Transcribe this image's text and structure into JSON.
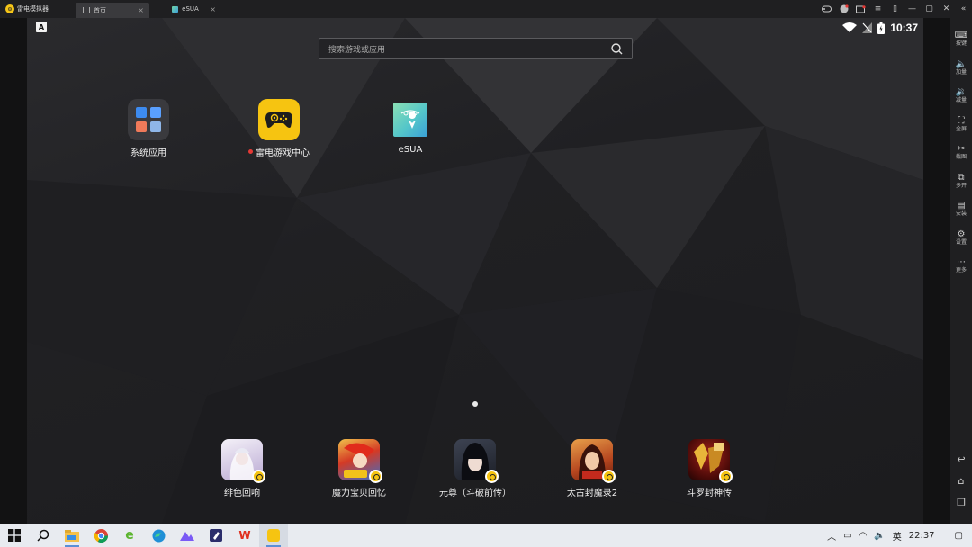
{
  "window": {
    "app_title": "雷电模拟器",
    "tabs": [
      {
        "label": "首页",
        "active": true
      },
      {
        "label": "eSUA",
        "active": false
      }
    ]
  },
  "android": {
    "badge": "A",
    "clock": "10:37",
    "search_placeholder": "搜索游戏或应用",
    "desktop_apps": [
      {
        "label": "系统应用",
        "icon": "folder-icon"
      },
      {
        "label": "雷电游戏中心",
        "icon": "gamepad-icon",
        "new_dot": true
      },
      {
        "label": "eSUA",
        "icon": "map-pin-icon"
      }
    ],
    "dock_apps": [
      {
        "label": "绯色回响",
        "color": "#e9e2f0"
      },
      {
        "label": "魔力宝贝回忆",
        "color": "#c2392b"
      },
      {
        "label": "元尊（斗破前传）",
        "color": "#2b2f3a"
      },
      {
        "label": "太古封魔录2",
        "color": "#a13a22"
      },
      {
        "label": "斗罗封神传",
        "color": "#5a0f0c"
      }
    ]
  },
  "toolbar": {
    "items": [
      {
        "label": "按键",
        "icon": "keyboard-icon"
      },
      {
        "label": "加量",
        "icon": "volume-up-icon"
      },
      {
        "label": "减量",
        "icon": "volume-down-icon"
      },
      {
        "label": "全屏",
        "icon": "fullscreen-icon"
      },
      {
        "label": "截图",
        "icon": "scissors-icon"
      },
      {
        "label": "多开",
        "icon": "multi-instance-icon"
      },
      {
        "label": "安装",
        "icon": "install-icon"
      },
      {
        "label": "设置",
        "icon": "gear-icon"
      },
      {
        "label": "更多",
        "icon": "more-icon"
      }
    ]
  },
  "taskbar": {
    "ime": "英",
    "time": "22:37"
  },
  "colors": {
    "accent_yellow": "#f6c411",
    "titlebar": "#1f1f21",
    "taskbar": "#e8ebf0"
  }
}
